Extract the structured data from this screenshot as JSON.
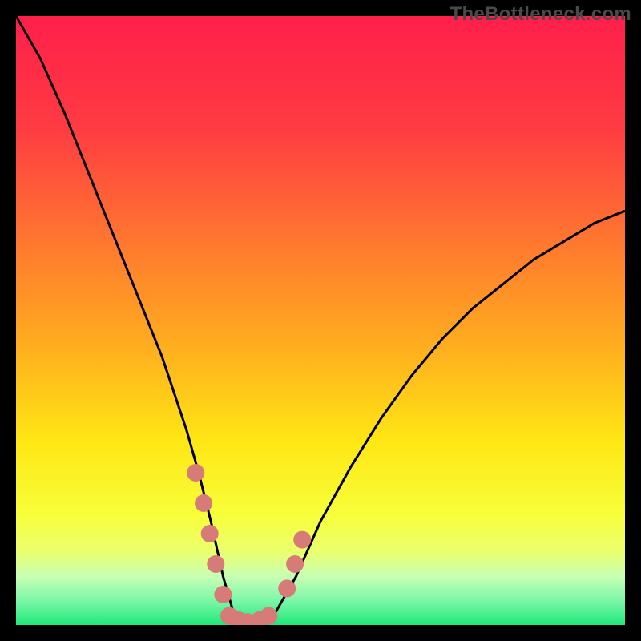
{
  "watermark": "TheBottleneck.com",
  "chart_data": {
    "type": "line",
    "title": "",
    "xlabel": "",
    "ylabel": "",
    "xlim": [
      0,
      100
    ],
    "ylim": [
      0,
      100
    ],
    "series": [
      {
        "name": "bottleneck-curve",
        "x": [
          0,
          4,
          8,
          12,
          16,
          20,
          24,
          28,
          30,
          32,
          34,
          36,
          38,
          40,
          42,
          46,
          50,
          55,
          60,
          65,
          70,
          75,
          80,
          85,
          90,
          95,
          100
        ],
        "y": [
          102,
          93,
          84,
          74,
          64,
          54,
          44,
          32,
          25,
          17,
          8,
          1,
          0,
          0,
          1,
          8,
          17,
          26,
          34,
          41,
          47,
          52,
          56,
          60,
          63,
          66,
          68
        ]
      }
    ],
    "optimal_band": {
      "y_min": 0,
      "y_max": 5
    },
    "near_band": {
      "y_min": 5,
      "y_max": 12
    },
    "markers": {
      "left_near": {
        "x": [
          29.5,
          30.8,
          31.8,
          32.8,
          34.0
        ],
        "y": [
          25,
          20,
          15,
          10,
          5
        ]
      },
      "bottom": {
        "x": [
          35.0,
          36.5,
          38.0,
          40.0,
          41.5
        ],
        "y": [
          1.5,
          0.8,
          0.5,
          0.8,
          1.5
        ]
      },
      "right_near": {
        "x": [
          44.5,
          45.8,
          47.0
        ],
        "y": [
          6,
          10,
          14
        ]
      }
    },
    "gradient_stops": [
      {
        "pct": 0,
        "color": "#ff1f4b"
      },
      {
        "pct": 18,
        "color": "#ff3a42"
      },
      {
        "pct": 38,
        "color": "#ff7a2e"
      },
      {
        "pct": 55,
        "color": "#ffb01e"
      },
      {
        "pct": 70,
        "color": "#ffe714"
      },
      {
        "pct": 82,
        "color": "#f7ff3a"
      },
      {
        "pct": 88,
        "color": "#eaff6e"
      },
      {
        "pct": 92,
        "color": "#c8ffb4"
      },
      {
        "pct": 96,
        "color": "#7cf7a8"
      },
      {
        "pct": 100,
        "color": "#1ee879"
      }
    ],
    "marker_color": "#d77b79",
    "curve_color": "#000000"
  }
}
